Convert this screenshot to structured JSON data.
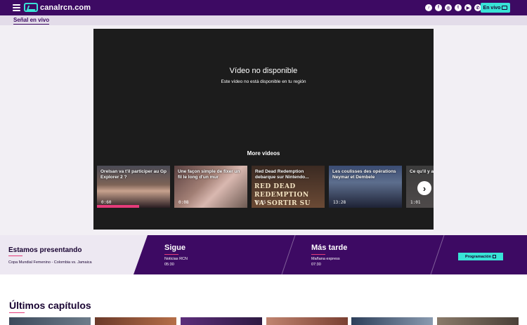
{
  "header": {
    "logo_text": "canalrcn.com",
    "social_icons": [
      "tiktok-icon",
      "facebook-icon",
      "instagram-icon",
      "twitter-icon",
      "youtube-icon",
      "whatsapp-icon"
    ],
    "live_button": "En vivo",
    "colors": {
      "bar": "#3d0a63",
      "accent": "#38e3d6"
    }
  },
  "subnav": {
    "link": "Señal en vivo"
  },
  "player": {
    "unavailable_title": "Vídeo no disponible",
    "unavailable_sub": "Este vídeo no está disponible en tu región",
    "more_title": "More videos",
    "cards": [
      {
        "title": "Orelsan va t'il participer au Gp Explorer 2 ?",
        "duration": "0:60"
      },
      {
        "title": "Une façon simple de fixer un fil le long d'un mur",
        "duration": "0:08"
      },
      {
        "title": "Red Dead Redemption debarque sur Nintendo...",
        "duration": "0:15",
        "overlay": "RED DEAD\nREDEMPTION\nVA SORTIR SU"
      },
      {
        "title": "Les coulisses des opérations Neymar et Dembele",
        "duration": "13:28"
      },
      {
        "title": "Ce qu'il y a",
        "duration": "1:01"
      }
    ]
  },
  "schedule": {
    "now": {
      "label": "Estamos presentando",
      "show": "Copa Mundial Femenino - Colombia vs. Jamaica"
    },
    "next": {
      "label": "Sigue",
      "show": "Noticias RCN",
      "time": "05:30"
    },
    "later": {
      "label": "Más tarde",
      "show": "Mañana express",
      "time": "07:30"
    },
    "program_button": "Programación"
  },
  "latest": {
    "title": "Últimos capítulos"
  }
}
